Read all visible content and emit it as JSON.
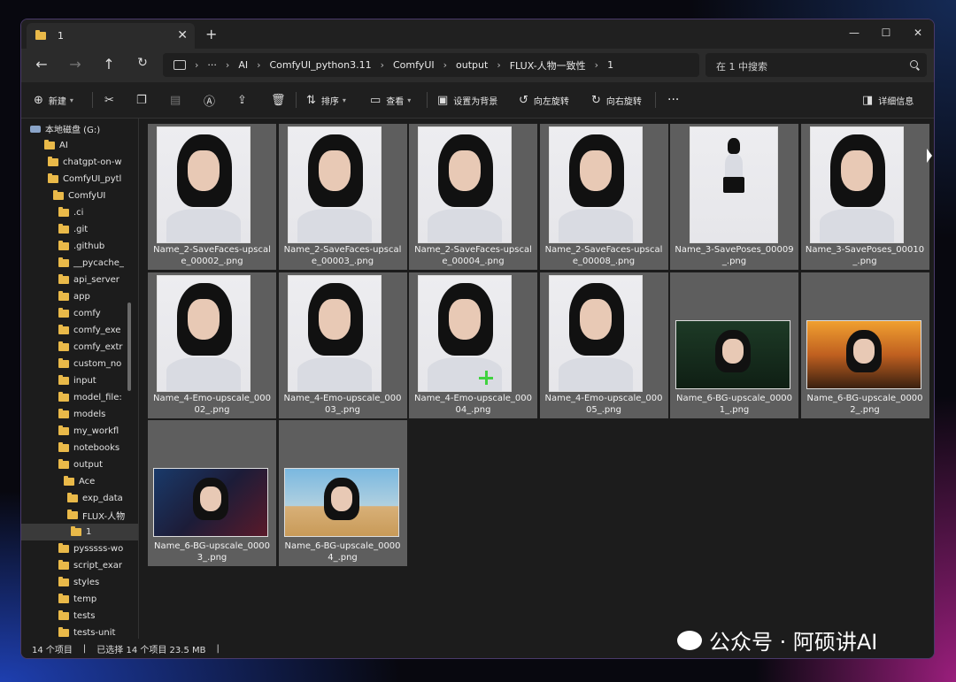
{
  "tab": {
    "title": "1"
  },
  "nav": {
    "breadcrumb": [
      "AI",
      "ComfyUI_python3.11",
      "ComfyUI",
      "output",
      "FLUX-人物一致性",
      "1"
    ],
    "more": "···",
    "search_placeholder": "在 1 中搜索"
  },
  "toolbar": {
    "new_label": "新建",
    "sort_label": "排序",
    "view_label": "查看",
    "set_bg_label": "设置为背景",
    "rotate_left_label": "向左旋转",
    "rotate_right_label": "向右旋转",
    "more_label": "···",
    "details_label": "详细信息"
  },
  "sidebar": {
    "items": [
      {
        "label": "本地磁盘 (G:)",
        "type": "drive"
      },
      {
        "label": "AI"
      },
      {
        "label": "chatgpt-on-w"
      },
      {
        "label": "ComfyUI_pytl"
      },
      {
        "label": "ComfyUI"
      },
      {
        "label": ".ci"
      },
      {
        "label": ".git"
      },
      {
        "label": ".github"
      },
      {
        "label": "__pycache_"
      },
      {
        "label": "api_server"
      },
      {
        "label": "app"
      },
      {
        "label": "comfy"
      },
      {
        "label": "comfy_exe"
      },
      {
        "label": "comfy_extr"
      },
      {
        "label": "custom_no"
      },
      {
        "label": "input"
      },
      {
        "label": "model_file:"
      },
      {
        "label": "models"
      },
      {
        "label": "my_workfl"
      },
      {
        "label": "notebooks"
      },
      {
        "label": "output"
      },
      {
        "label": "Ace"
      },
      {
        "label": "exp_data"
      },
      {
        "label": "FLUX-人物"
      },
      {
        "label": "1",
        "selected": true
      },
      {
        "label": "pysssss-wo"
      },
      {
        "label": "script_exar"
      },
      {
        "label": "styles"
      },
      {
        "label": "temp"
      },
      {
        "label": "tests"
      },
      {
        "label": "tests-unit"
      }
    ]
  },
  "files": [
    {
      "name": "Name_2-SaveFaces-upscale_00002_.png",
      "kind": "portrait"
    },
    {
      "name": "Name_2-SaveFaces-upscale_00003_.png",
      "kind": "portrait"
    },
    {
      "name": "Name_2-SaveFaces-upscale_00004_.png",
      "kind": "portrait"
    },
    {
      "name": "Name_2-SaveFaces-upscale_00008_.png",
      "kind": "portrait"
    },
    {
      "name": "Name_3-SavePoses_00009_.png",
      "kind": "fullbody"
    },
    {
      "name": "Name_3-SavePoses_00010_.png",
      "kind": "portrait"
    },
    {
      "name": "Name_4-Emo-upscale_00002_.png",
      "kind": "portrait"
    },
    {
      "name": "Name_4-Emo-upscale_00003_.png",
      "kind": "portrait"
    },
    {
      "name": "Name_4-Emo-upscale_00004_.png",
      "kind": "portrait"
    },
    {
      "name": "Name_4-Emo-upscale_00005_.png",
      "kind": "portrait"
    },
    {
      "name": "Name_6-BG-upscale_00001_.png",
      "kind": "landscape-green"
    },
    {
      "name": "Name_6-BG-upscale_00002_.png",
      "kind": "landscape-sunset"
    },
    {
      "name": "Name_6-BG-upscale_00003_.png",
      "kind": "landscape-night"
    },
    {
      "name": "Name_6-BG-upscale_00004_.png",
      "kind": "landscape-desert"
    }
  ],
  "status": {
    "item_count": "14 个项目",
    "selected": "已选择 14 个项目 23.5 MB"
  },
  "watermark": "公众号 · 阿硕讲AI"
}
